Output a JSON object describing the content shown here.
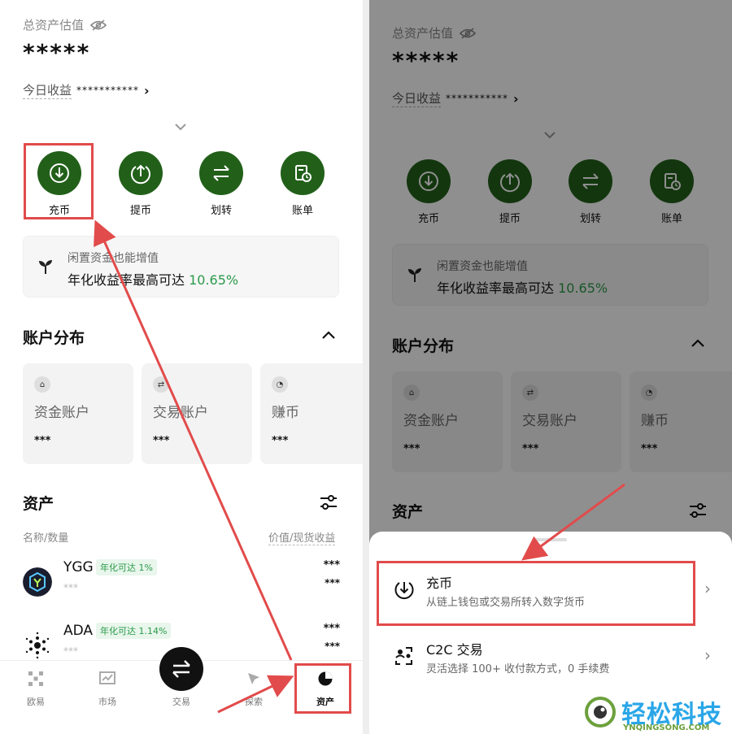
{
  "assets_page": {
    "total_label": "总资产估值",
    "total_value": "*****",
    "today_label": "今日收益",
    "today_value": "***********",
    "actions": [
      {
        "label": "充币",
        "icon": "deposit-icon"
      },
      {
        "label": "提币",
        "icon": "withdraw-icon"
      },
      {
        "label": "划转",
        "icon": "transfer-icon"
      },
      {
        "label": "账单",
        "icon": "bill-icon"
      }
    ],
    "promo": {
      "line1": "闲置资金也能增值",
      "line2": "年化收益率最高可达",
      "rate": "10.65%"
    },
    "distribution_title": "账户分布",
    "accounts": [
      {
        "name": "资金账户",
        "value": "***",
        "icon": "bag-icon"
      },
      {
        "name": "交易账户",
        "value": "***",
        "icon": "exchange-icon"
      },
      {
        "name": "赚币",
        "value": "***",
        "icon": "piggy-icon"
      }
    ],
    "assets_title": "资产",
    "col_left": "名称/数量",
    "col_right": "价值/现货收益",
    "assets": [
      {
        "symbol": "YGG",
        "apy": "年化可达 1%",
        "amount": "***",
        "value": "***",
        "pnl": "***"
      },
      {
        "symbol": "ADA",
        "apy": "年化可达 1.14%",
        "amount": "***",
        "value": "***",
        "pnl": "***"
      }
    ]
  },
  "nav": [
    {
      "label": "欧易",
      "icon": "okx-icon"
    },
    {
      "label": "市场",
      "icon": "market-icon"
    },
    {
      "label": "交易",
      "icon": "trade-icon"
    },
    {
      "label": "探索",
      "icon": "explore-icon"
    },
    {
      "label": "资产",
      "icon": "assets-icon"
    }
  ],
  "sheet": {
    "options": [
      {
        "title": "充币",
        "desc": "从链上钱包或交易所转入数字货币",
        "icon": "deposit-icon"
      },
      {
        "title": "C2C 交易",
        "desc": "灵活选择 100+ 收付款方式，0 手续费",
        "icon": "c2c-icon"
      }
    ]
  },
  "watermark": {
    "name": "轻松科技",
    "url": "YNQINGSONG.COM"
  },
  "colors": {
    "brand_green": "#22601a",
    "rate_green": "#2b9a4a",
    "highlight_red": "#e24b4b"
  }
}
